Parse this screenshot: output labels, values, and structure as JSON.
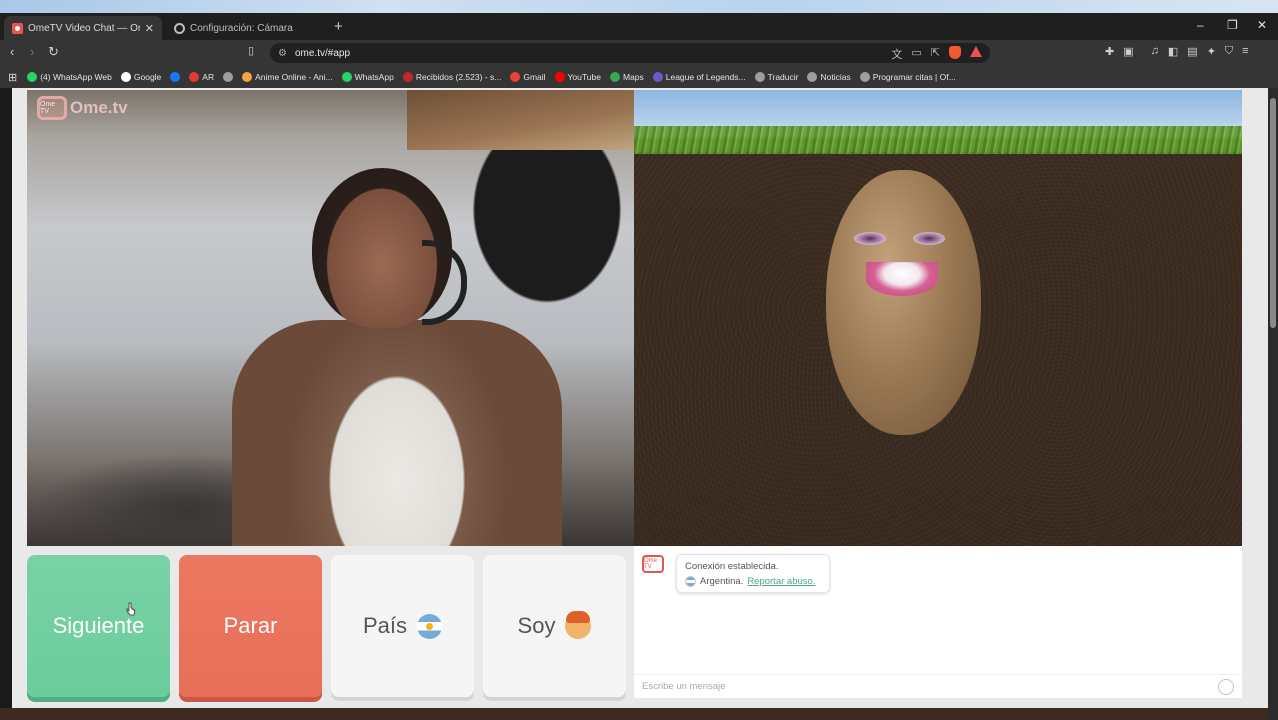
{
  "browser": {
    "tabs": [
      {
        "title": "OmeTV Video Chat — Omeg",
        "active": true
      },
      {
        "title": "Configuración: Cámara",
        "active": false
      }
    ],
    "new_tab_label": "+",
    "url": "ome.tv/#app",
    "window_controls": {
      "minimize": "–",
      "maximize": "❐",
      "close": "✕"
    },
    "bookmarks": [
      {
        "label": "(4) WhatsApp Web",
        "color": "#25d366"
      },
      {
        "label": "Google",
        "color": "#ffffff"
      },
      {
        "label": "",
        "color": "#1877f2"
      },
      {
        "label": "AR",
        "color": "#e53935"
      },
      {
        "label": "",
        "color": "#9e9e9e"
      },
      {
        "label": "Anime Online - Ani...",
        "color": "#f2a541"
      },
      {
        "label": "WhatsApp",
        "color": "#25d366"
      },
      {
        "label": "Recibidos (2.523) - s...",
        "color": "#c62828"
      },
      {
        "label": "Gmail",
        "color": "#ea4335"
      },
      {
        "label": "YouTube",
        "color": "#ff0000"
      },
      {
        "label": "Maps",
        "color": "#34a853"
      },
      {
        "label": "League of Legends...",
        "color": "#6a5acd"
      },
      {
        "label": "Traducir",
        "color": "#9e9e9e"
      },
      {
        "label": "Noticias",
        "color": "#9e9e9e"
      },
      {
        "label": "Programar citas | Of...",
        "color": "#9e9e9e"
      }
    ]
  },
  "app": {
    "logo_text": "Ome.tv",
    "logo_box_text": "Ome TV",
    "controls": {
      "next_label": "Siguiente",
      "stop_label": "Parar",
      "country_label": "País",
      "gender_label": "Soy"
    },
    "chat": {
      "status": "Conexión establecida.",
      "country": "Argentina.",
      "report_link": "Reportar abuso.",
      "input_placeholder": "Escribe un mensaje"
    },
    "colors": {
      "next": "#6ccc9c",
      "stop": "#e86f59",
      "accent_link": "#4aa689"
    }
  }
}
